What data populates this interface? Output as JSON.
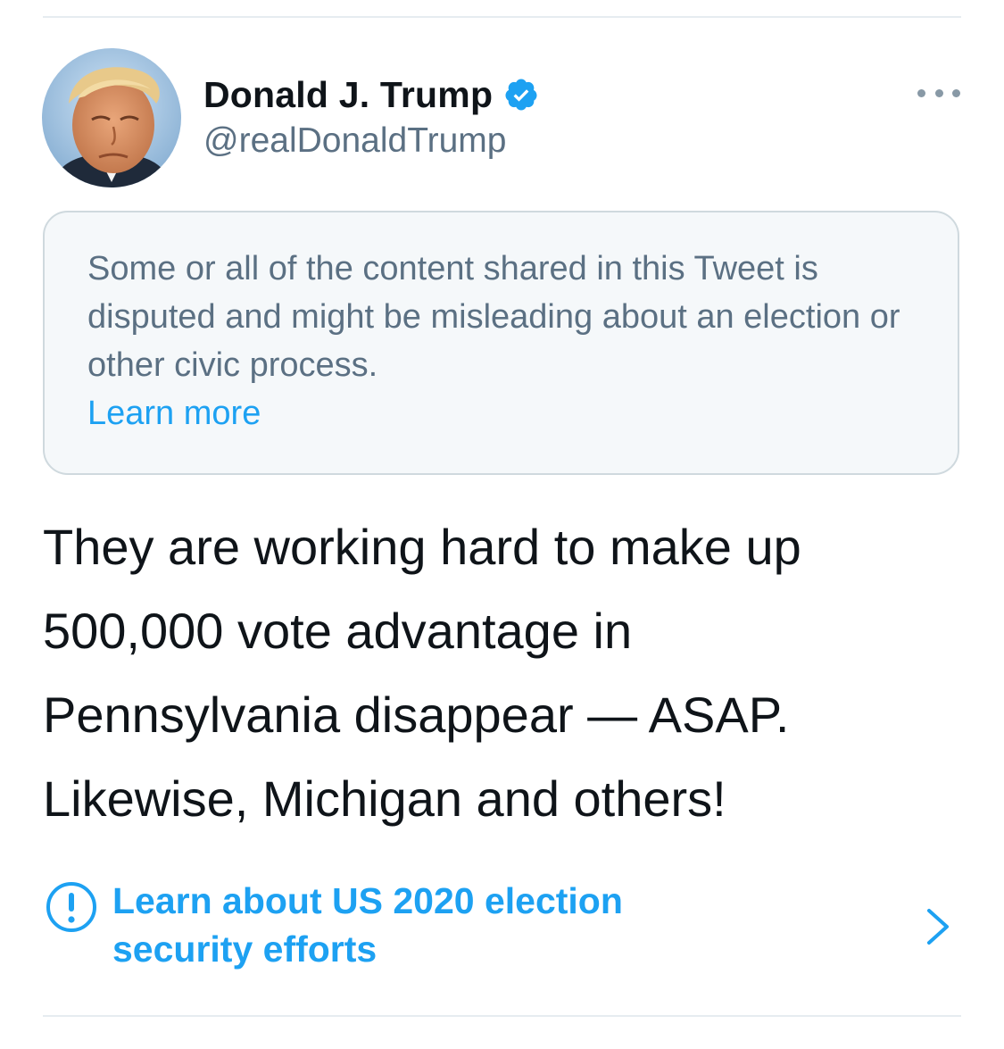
{
  "tweet": {
    "author": {
      "display_name": "Donald J. Trump",
      "handle": "@realDonaldTrump",
      "verified": true,
      "avatar_icon": "avatar-portrait"
    },
    "more_icon": "more-options-icon",
    "notice": {
      "text": "Some or all of the content shared in this Tweet is disputed and might be misleading about an election or other civic process.",
      "link_label": "Learn more"
    },
    "body": "They are working hard to make up\n500,000 vote advantage in\nPennsylvania disappear — ASAP.\nLikewise, Michigan and others!",
    "election_link": {
      "icon": "exclamation-circle-icon",
      "label": "Learn about US 2020 election\nsecurity efforts",
      "chevron": "chevron-right-icon"
    }
  },
  "colors": {
    "accent": "#1da1f2",
    "text_primary": "#0f1419",
    "text_secondary": "#5b7083",
    "notice_bg": "#f5f8fa",
    "notice_border": "#cfd9de",
    "divider": "#e6ecf0"
  }
}
